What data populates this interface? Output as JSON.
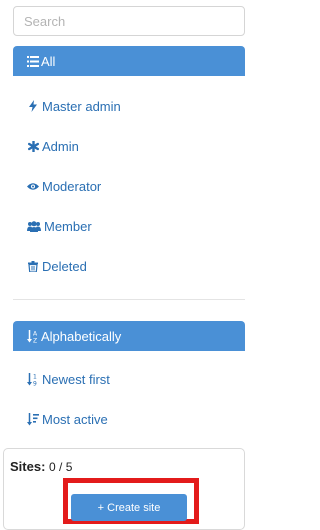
{
  "search": {
    "placeholder": "Search"
  },
  "filters": [
    {
      "label": "All",
      "icon": "list-icon"
    },
    {
      "label": "Master admin",
      "icon": "bolt-icon"
    },
    {
      "label": "Admin",
      "icon": "asterisk-icon"
    },
    {
      "label": "Moderator",
      "icon": "eye-icon"
    },
    {
      "label": "Member",
      "icon": "users-icon"
    },
    {
      "label": "Deleted",
      "icon": "trash-icon"
    }
  ],
  "sorts": [
    {
      "label": "Alphabetically",
      "icon": "sort-alpha-icon"
    },
    {
      "label": "Newest first",
      "icon": "sort-numeric-icon"
    },
    {
      "label": "Most active",
      "icon": "sort-amount-icon"
    }
  ],
  "sites": {
    "label": "Sites:",
    "count": "0 / 5",
    "create_label": "+ Create site"
  },
  "colors": {
    "accent": "#4a90d6",
    "link": "#2a6fb3",
    "highlight": "#e31b1b"
  }
}
